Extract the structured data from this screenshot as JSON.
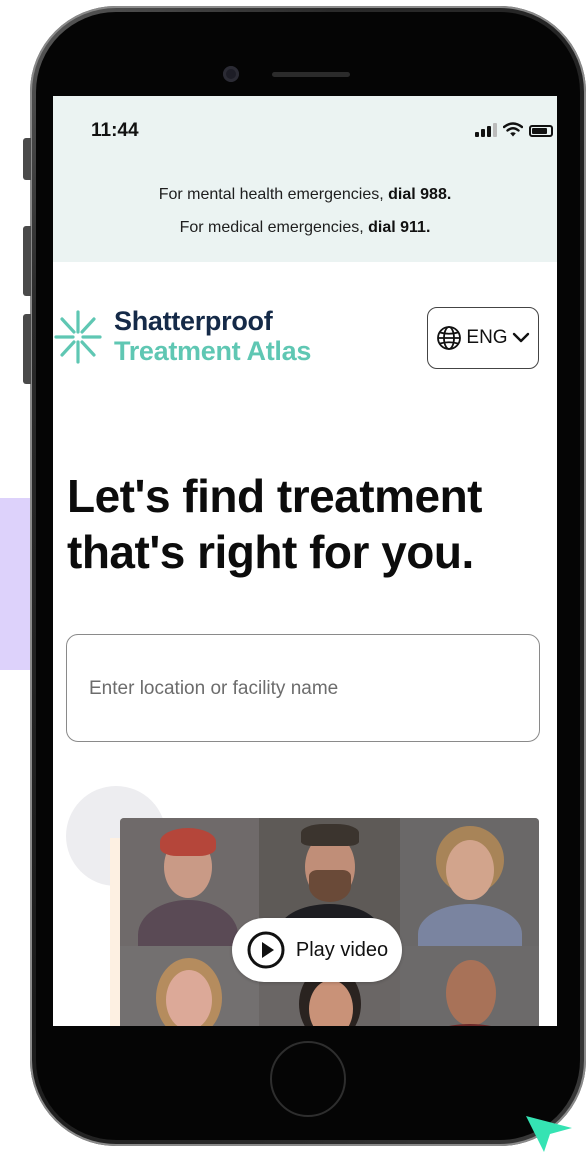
{
  "status_bar": {
    "time": "11:44"
  },
  "emergency_banner": {
    "line1_prefix": "For mental health emergencies, ",
    "line1_bold": "dial 988.",
    "line2_prefix": "For medical emergencies, ",
    "line2_bold": "dial 911."
  },
  "header": {
    "logo_line1": "Shatterproof",
    "logo_line2": "Treatment Atlas",
    "language_label": "ENG"
  },
  "hero": {
    "title_line1": "Let's find treatment",
    "title_line2": "that's right for you."
  },
  "search": {
    "placeholder": "Enter location or facility name",
    "value": ""
  },
  "video": {
    "play_label": "Play video"
  },
  "icons": {
    "language": "globe-icon",
    "dropdown": "chevron-down-icon",
    "play": "play-icon",
    "logo": "starburst-logo-icon",
    "cursor": "mouse-cursor-icon"
  },
  "colors": {
    "brand_navy": "#152a48",
    "brand_teal": "#5fc7b3",
    "banner_bg": "#ebf3f2",
    "cursor": "#35e3b3"
  }
}
